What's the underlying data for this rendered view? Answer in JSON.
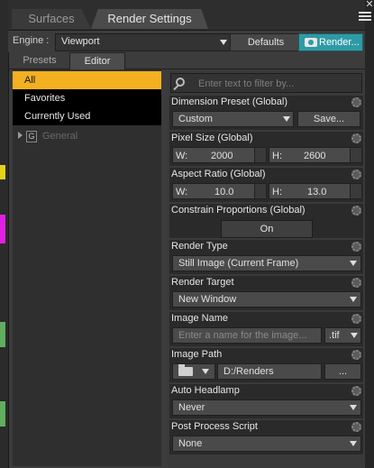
{
  "tabs": [
    {
      "label": "Surfaces"
    },
    {
      "label": "Render Settings"
    }
  ],
  "engine": {
    "label": "Engine :",
    "value": "Viewport"
  },
  "buttons": {
    "defaults": "Defaults",
    "render": "Render..."
  },
  "subtabs": [
    {
      "label": "Presets"
    },
    {
      "label": "Editor"
    }
  ],
  "categories": [
    "All",
    "Favorites",
    "Currently Used"
  ],
  "general": {
    "icon_letter": "G",
    "label": "General"
  },
  "filter": {
    "placeholder": "Enter text to filter by..."
  },
  "properties": {
    "dimension_preset": {
      "title": "Dimension Preset (Global)",
      "value": "Custom",
      "save": "Save..."
    },
    "pixel_size": {
      "title": "Pixel Size (Global)",
      "w_label": "W:",
      "w": "2000",
      "h_label": "H:",
      "h": "2600"
    },
    "aspect_ratio": {
      "title": "Aspect Ratio (Global)",
      "w_label": "W:",
      "w": "10.0",
      "h_label": "H:",
      "h": "13.0"
    },
    "constrain": {
      "title": "Constrain Proportions (Global)",
      "value": "On"
    },
    "render_type": {
      "title": "Render Type",
      "value": "Still Image (Current Frame)"
    },
    "render_target": {
      "title": "Render Target",
      "value": "New Window"
    },
    "image_name": {
      "title": "Image Name",
      "placeholder": "Enter a name for the image...",
      "ext": ".tif"
    },
    "image_path": {
      "title": "Image Path",
      "value": "D:/Renders",
      "browse": "..."
    },
    "auto_headlamp": {
      "title": "Auto Headlamp",
      "value": "Never"
    },
    "post_process": {
      "title": "Post Process Script",
      "value": "None"
    }
  },
  "colors": {
    "accent": "#f3b021",
    "render_button": "#2f9aa6"
  },
  "window": {
    "close_glyph": "✕"
  }
}
